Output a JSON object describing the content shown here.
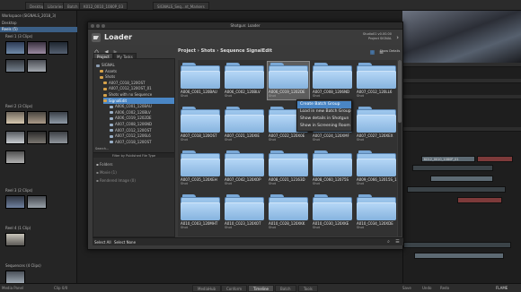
{
  "background": {
    "tabs": [
      "Desktop",
      "Libraries",
      "Batch",
      "K012_0010_1080P_03",
      "SIGNALS_Seq...nt_Markers"
    ],
    "panel_title": "Workspace (SIGNALS_2018_3)",
    "panel_items": [
      "Desktop",
      "Reels (5)",
      "Reel 1 (3 Clips)",
      "Reel 2 (3 Clips)",
      "Reel 3 (2 Clips)",
      "Reel 4 (1 Clip)",
      "Sequences (4 Clips)"
    ],
    "clip_name": "K012_0010_1080P_01",
    "bottom_tabs": [
      "MediaHub",
      "Conform",
      "Timeline",
      "Batch",
      "Tools"
    ],
    "bottom_left": [
      "Media Panel",
      "Clip 0/0"
    ],
    "bottom_right": [
      "Save",
      "Undo",
      "Redo",
      "FLAME"
    ]
  },
  "loader": {
    "window_title": "Shotgun: Loader",
    "title": "Loader",
    "header_info": [
      "Studio01 v0.00.00",
      "Project SIGNAL"
    ],
    "breadcrumb": "Project › Shots › Sequence SignalEdit",
    "search_placeholder": "Search",
    "show_details": "Show Details",
    "pane_tabs": [
      "Project",
      "My Tasks"
    ],
    "tree": [
      {
        "label": "SIGNAL",
        "level": 0
      },
      {
        "label": "Assets",
        "level": 1
      },
      {
        "label": "Shots",
        "level": 1
      },
      {
        "label": "A007_C018_120OST",
        "level": 2
      },
      {
        "label": "A007_C012_120OST_01",
        "level": 2
      },
      {
        "label": "Shots with no Sequence",
        "level": 2
      },
      {
        "label": "SignalEdit",
        "level": 2,
        "selected": true
      },
      {
        "label": "A006_C001_120BAU",
        "level": 3
      },
      {
        "label": "A006_C002_120BLV",
        "level": 3
      },
      {
        "label": "A006_C019_1202DE",
        "level": 3
      },
      {
        "label": "A007_C008_1206ND",
        "level": 3
      },
      {
        "label": "A007_C012_120OST",
        "level": 3
      },
      {
        "label": "A007_C012_1206L6",
        "level": 3
      },
      {
        "label": "A007_C018_120OST",
        "level": 3
      }
    ],
    "search_label": "Search...",
    "filter_label": "Filter by Published File Type",
    "lower_items": [
      "Folders",
      "Movie (1)",
      "Rendered Image (0)"
    ],
    "footer": {
      "select_all": "Select All",
      "select_none": "Select None"
    },
    "shots": [
      "A006_C001_120BAU",
      "A006_C002_120BLV",
      "A006_C019_1202DE",
      "A007_C008_1206ND",
      "A007_C012_120LL6",
      "A007_C018_120OST",
      "A007_C021_120XIE",
      "A007_C022_120X0E",
      "A007_C024_120XMF",
      "A007_C027_120XEX",
      "A007_C035_120XEH",
      "A007_C042_120XOP",
      "A008_C021_12163D",
      "A008_C060_12075S",
      "A009_C066_12015S_1",
      "A010_C003_120MHT",
      "A010_C023_120XOT",
      "A010_C028_120XKK",
      "A010_C030_120XKE",
      "A010_C034_120XDE"
    ],
    "shot_type": "Shot",
    "selected_index": 2,
    "context_menu": [
      "Create Batch Group",
      "Load in new Batch Group",
      "Show details in Shotgun",
      "Show in Screening Room"
    ],
    "context_hover": 0
  }
}
